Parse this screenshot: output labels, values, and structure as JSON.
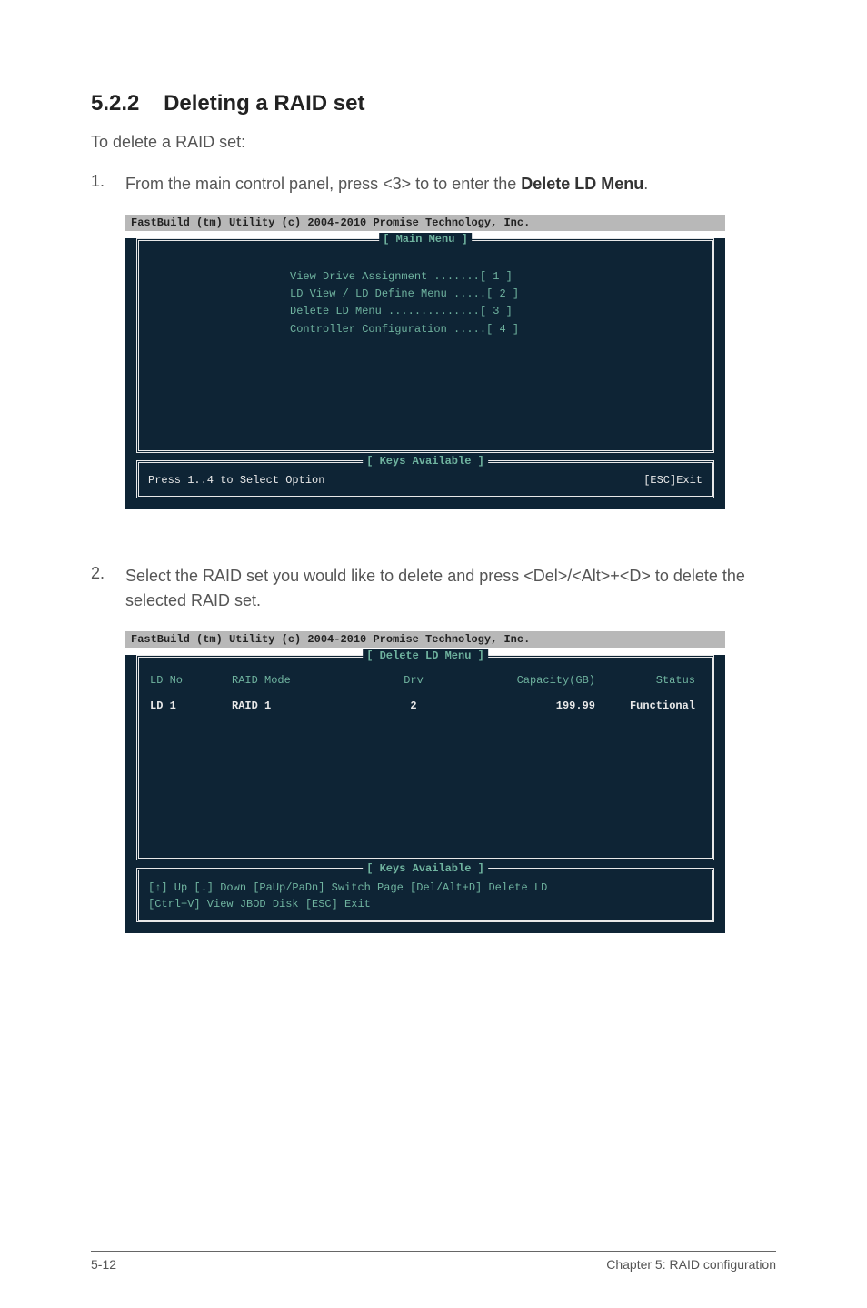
{
  "section": {
    "number": "5.2.2",
    "title": "Deleting a RAID set"
  },
  "intro": "To delete a RAID set:",
  "steps": [
    {
      "num": "1.",
      "text_before": "From the main control panel, press <3> to to enter the ",
      "bold": "Delete LD Menu",
      "text_after": "."
    },
    {
      "num": "2.",
      "text_before": "Select the RAID set you would like to delete and press <Del>/<Alt>+<D> to delete the selected RAID set.",
      "bold": "",
      "text_after": ""
    }
  ],
  "terminal1": {
    "titlebar": "FastBuild (tm) Utility (c) 2004-2010 Promise Technology, Inc.",
    "main_label": "[ Main Menu ]",
    "menu_items": [
      "View Drive Assignment .......[ 1 ]",
      "LD View / LD Define Menu .....[ 2 ]",
      "Delete LD Menu ..............[ 3 ]",
      "Controller Configuration .....[ 4 ]"
    ],
    "keys_label": "[ Keys Available ]",
    "keys_left": "Press 1..4 to Select Option",
    "keys_right": "[ESC]Exit"
  },
  "terminal2": {
    "titlebar": "FastBuild (tm) Utility (c) 2004-2010 Promise Technology, Inc.",
    "main_label": "[ Delete LD Menu ]",
    "headers": {
      "ldno": "LD No",
      "raid": "RAID Mode",
      "drv": "Drv",
      "cap": "Capacity(GB)",
      "status": "Status"
    },
    "row": {
      "ldno": "LD  1",
      "raid": "RAID 1",
      "drv": "2",
      "cap": "199.99",
      "status": "Functional"
    },
    "keys_label": "[ Keys Available ]",
    "keys_line1": "[↑] Up [↓] Down [PaUp/PaDn] Switch Page [Del/Alt+D] Delete LD",
    "keys_line2": "[Ctrl+V] View JBOD Disk  [ESC] Exit"
  },
  "footer": {
    "left": "5-12",
    "right": "Chapter 5: RAID configuration"
  }
}
